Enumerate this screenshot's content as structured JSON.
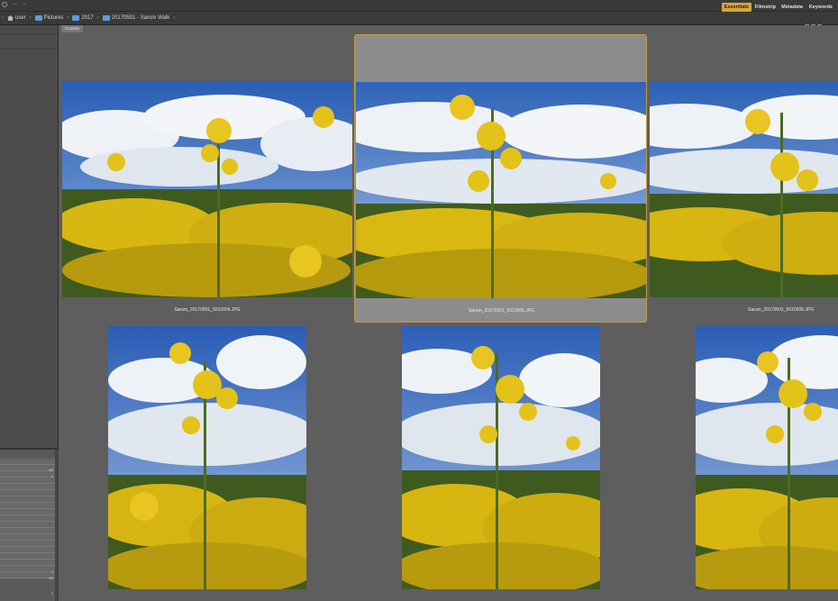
{
  "breadcrumb": [
    {
      "label": "user",
      "icon": "home-icon"
    },
    {
      "label": "Pictures",
      "icon": "folder-icon"
    },
    {
      "label": "2017",
      "icon": "folder-icon"
    },
    {
      "label": "20170501 - Sarum Walk",
      "icon": "folder-icon"
    }
  ],
  "workspaces": {
    "essentials": "Essentials",
    "filmstrip": "Filmstrip",
    "metadata": "Metadata",
    "keywords": "Keywords"
  },
  "content_tab": "Content",
  "thumbnails": [
    {
      "filename": "Sarum_20170501_5010004.JPG",
      "orientation": "landscape",
      "selected": false
    },
    {
      "filename": "Sarum_20170501_5010005.JPG",
      "orientation": "landscape",
      "selected": true
    },
    {
      "filename": "Sarum_20170501_5010006.JPG",
      "orientation": "landscape",
      "selected": false
    },
    {
      "filename": "",
      "orientation": "portrait",
      "selected": false
    },
    {
      "filename": "",
      "orientation": "portrait",
      "selected": false
    },
    {
      "filename": "",
      "orientation": "portrait",
      "selected": false
    }
  ],
  "meta_values": [
    "80",
    "1",
    "1",
    "80",
    "1"
  ],
  "colors": {
    "accent": "#d9a43a",
    "selection_border": "#c69b45",
    "sky": "#2f63b8",
    "rapeseed": "#e3c21a"
  }
}
